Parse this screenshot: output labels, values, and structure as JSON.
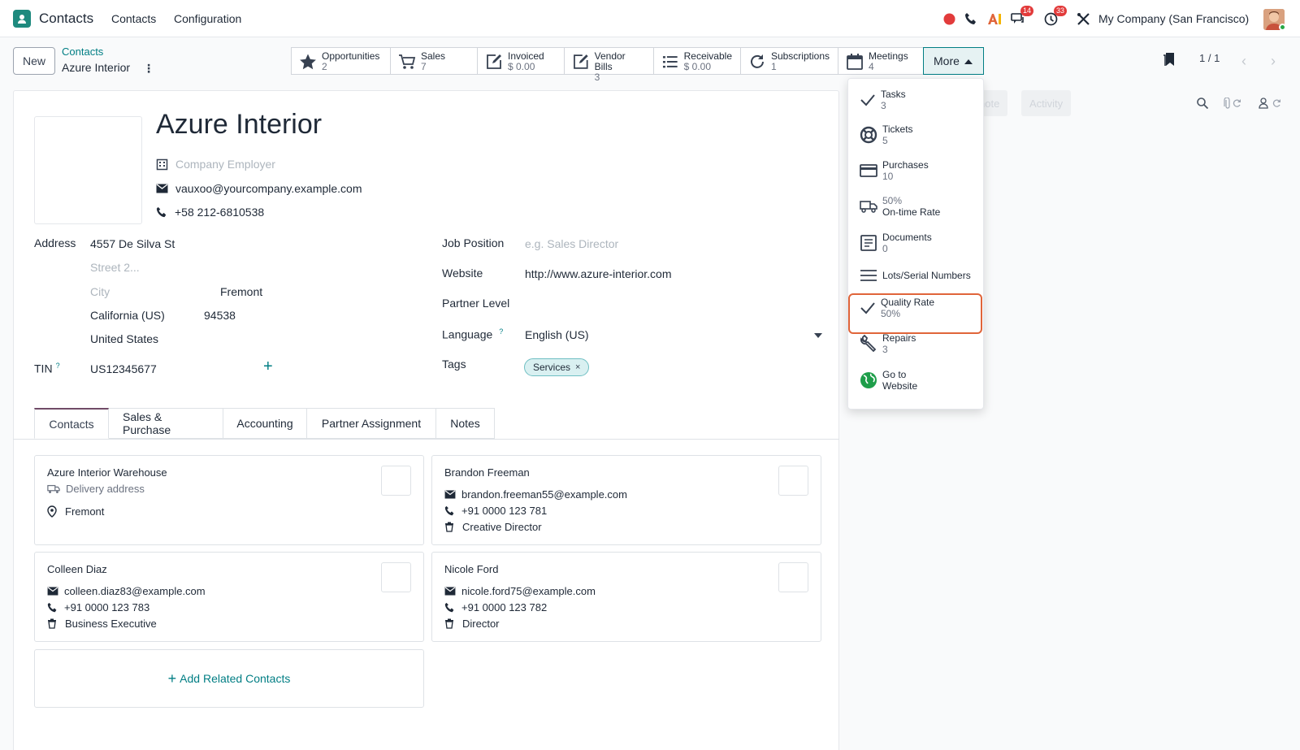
{
  "navbar": {
    "app_title": "Contacts",
    "menus": [
      "Contacts",
      "Configuration"
    ],
    "messages_badge": "14",
    "activities_badge": "33",
    "company": "My Company (San Francisco)"
  },
  "control": {
    "new_label": "New",
    "breadcrumb_parent": "Contacts",
    "breadcrumb_current": "Azure Interior",
    "pager": "1 / 1",
    "more_label": "More"
  },
  "stat_buttons": [
    {
      "label": "Opportunities",
      "value": "2",
      "icon": "star-icon"
    },
    {
      "label": "Sales",
      "value": "7",
      "icon": "cart-icon"
    },
    {
      "label": "Invoiced",
      "value": "$ 0.00",
      "icon": "edit-icon"
    },
    {
      "label": "Vendor Bills",
      "value": "3",
      "icon": "edit-icon"
    },
    {
      "label": "Receivable",
      "value": "$ 0.00",
      "icon": "list-icon"
    },
    {
      "label": "Subscriptions",
      "value": "1",
      "icon": "refresh-icon"
    },
    {
      "label": "Meetings",
      "value": "4",
      "icon": "calendar-icon"
    }
  ],
  "more_menu": [
    {
      "label": "Tasks",
      "value": "3",
      "icon": "check-icon"
    },
    {
      "label": "Tickets",
      "value": "5",
      "icon": "lifebuoy-icon"
    },
    {
      "label": "Purchases",
      "value": "10",
      "icon": "credit-card-icon"
    },
    {
      "label": "50%",
      "value": "On-time Rate",
      "icon": "truck-icon"
    },
    {
      "label": "Documents",
      "value": "0",
      "icon": "document-icon"
    },
    {
      "label": "Lots/Serial Numbers",
      "value": "",
      "icon": "lines-icon"
    },
    {
      "label": "Quality Rate",
      "value": "50%",
      "icon": "check-icon"
    },
    {
      "label": "Repairs",
      "value": "3",
      "icon": "wrench-icon"
    },
    {
      "label": "Go to",
      "value": "Website",
      "icon": "globe-icon"
    }
  ],
  "chatter": {
    "note": "note",
    "activity": "Activity"
  },
  "partner": {
    "name": "Azure Interior",
    "company_placeholder": "Company Employer",
    "email": "vauxoo@yourcompany.example.com",
    "phone": "+58 212-6810538"
  },
  "address": {
    "label": "Address",
    "street": "4557 De Silva St",
    "street2_placeholder": "Street 2...",
    "city_placeholder": "City",
    "city": "Fremont",
    "state": "California (US)",
    "zip": "94538",
    "country": "United States"
  },
  "tin": {
    "label": "TIN",
    "help": "?",
    "value": "US12345677"
  },
  "right_fields": {
    "job_label": "Job Position",
    "job_placeholder": "e.g. Sales Director",
    "website_label": "Website",
    "website": "http://www.azure-interior.com",
    "partner_level_label": "Partner Level",
    "language_label": "Language",
    "language_help": "?",
    "language": "English (US)",
    "tags_label": "Tags",
    "tag": "Services"
  },
  "tabs": [
    "Contacts",
    "Sales & Purchase",
    "Accounting",
    "Partner Assignment",
    "Notes"
  ],
  "contacts": [
    {
      "name": "Azure Interior Warehouse",
      "subtitle": "Delivery address",
      "city": "Fremont"
    },
    {
      "name": "Brandon Freeman",
      "email": "brandon.freeman55@example.com",
      "phone": "+91 0000 123 781",
      "job": "Creative Director"
    },
    {
      "name": "Colleen Diaz",
      "email": "colleen.diaz83@example.com",
      "phone": "+91 0000 123 783",
      "job": "Business Executive"
    },
    {
      "name": "Nicole Ford",
      "email": "nicole.ford75@example.com",
      "phone": "+91 0000 123 782",
      "job": "Director"
    }
  ],
  "add_related": "Add Related Contacts",
  "colors": {
    "brand": "#017e84",
    "accent": "#714b67",
    "highlight": "#e0653a"
  }
}
